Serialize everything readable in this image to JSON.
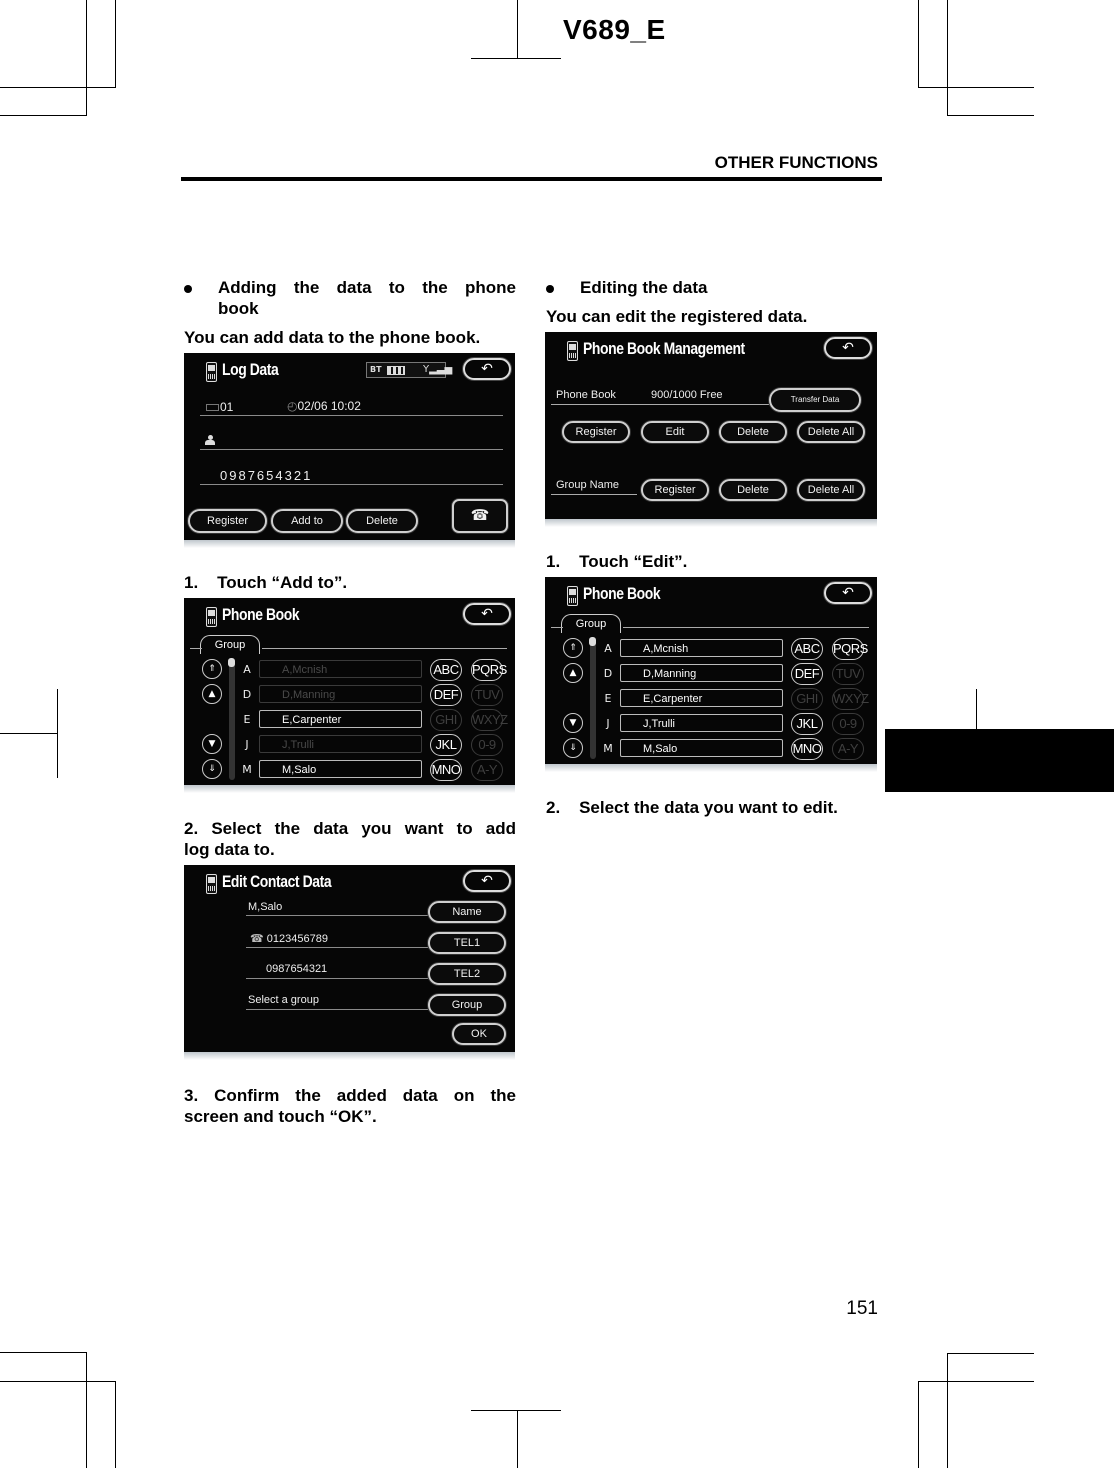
{
  "page": {
    "doc_id": "V689_E",
    "section_title": "OTHER FUNCTIONS",
    "page_number": "151"
  },
  "left_column": {
    "heading": "Adding the data to the phone book",
    "heading_line1": "Adding the data to the phone",
    "heading_line2": "book",
    "intro": "You can add data to the phone book.",
    "step1": "1.    Touch “Add to”.",
    "step2_line1": "2.   Select the data you want to add",
    "step2_line2": "log data to.",
    "step3_line1": "3.   Confirm the added data on the",
    "step3_line2": "screen and touch “OK”.",
    "log_data_screen": {
      "title": "Log Data",
      "status_bt": "BT",
      "entry_no": "01",
      "datetime": "02/06 10:02",
      "number": "0987654321",
      "buttons": [
        "Register",
        "Add to",
        "Delete"
      ],
      "back_icon": "↶",
      "call_icon": "☎"
    },
    "phone_book_screen": {
      "title": "Phone Book",
      "group_tab": "Group",
      "letters": [
        "A",
        "D",
        "E",
        "J",
        "M"
      ],
      "entries": [
        {
          "name": "A,Mcnish",
          "enabled": false
        },
        {
          "name": "D,Manning",
          "enabled": false
        },
        {
          "name": "E,Carpenter",
          "enabled": true
        },
        {
          "name": "J,Trulli",
          "enabled": false
        },
        {
          "name": "M,Salo",
          "enabled": true
        }
      ],
      "keys": [
        {
          "label": "ABC",
          "enabled": true
        },
        {
          "label": "PQRS",
          "enabled": true
        },
        {
          "label": "DEF",
          "enabled": true
        },
        {
          "label": "TUV",
          "enabled": false
        },
        {
          "label": "GHI",
          "enabled": false
        },
        {
          "label": "WXYZ",
          "enabled": false
        },
        {
          "label": "JKL",
          "enabled": true
        },
        {
          "label": "0-9",
          "enabled": false
        },
        {
          "label": "MNO",
          "enabled": true
        },
        {
          "label": "A-Y",
          "enabled": false
        }
      ],
      "scroll_icons": [
        "⇑",
        "▲",
        "▼",
        "⇓"
      ]
    },
    "edit_contact_screen": {
      "title": "Edit Contact Data",
      "name": "M,Salo",
      "tel1": "0123456789",
      "tel2": "0987654321",
      "group_text": "Select a group",
      "buttons": [
        "Name",
        "TEL1",
        "TEL2",
        "Group"
      ],
      "ok": "OK"
    }
  },
  "right_column": {
    "heading": "Editing the data",
    "intro": "You can edit the registered data.",
    "step1": "1.    Touch “Edit”.",
    "step2": "2.    Select the data you want to edit.",
    "management_screen": {
      "title": "Phone Book Management",
      "phone_book_label": "Phone Book",
      "free_count": "900/1000 Free",
      "transfer_button": "Transfer Data",
      "phone_book_buttons": [
        "Register",
        "Edit",
        "Delete",
        "Delete All"
      ],
      "group_label": "Group Name",
      "group_buttons": [
        "Register",
        "Delete",
        "Delete All"
      ]
    },
    "phone_book_screen": {
      "title": "Phone Book",
      "group_tab": "Group",
      "letters": [
        "A",
        "D",
        "E",
        "J",
        "M"
      ],
      "entries": [
        "A,Mcnish",
        "D,Manning",
        "E,Carpenter",
        "J,Trulli",
        "M,Salo"
      ],
      "keys": [
        {
          "label": "ABC",
          "enabled": true
        },
        {
          "label": "PQRS",
          "enabled": true
        },
        {
          "label": "DEF",
          "enabled": true
        },
        {
          "label": "TUV",
          "enabled": false
        },
        {
          "label": "GHI",
          "enabled": false
        },
        {
          "label": "WXYZ",
          "enabled": false
        },
        {
          "label": "JKL",
          "enabled": true
        },
        {
          "label": "0-9",
          "enabled": false
        },
        {
          "label": "MNO",
          "enabled": true
        },
        {
          "label": "A-Y",
          "enabled": false
        }
      ]
    }
  }
}
